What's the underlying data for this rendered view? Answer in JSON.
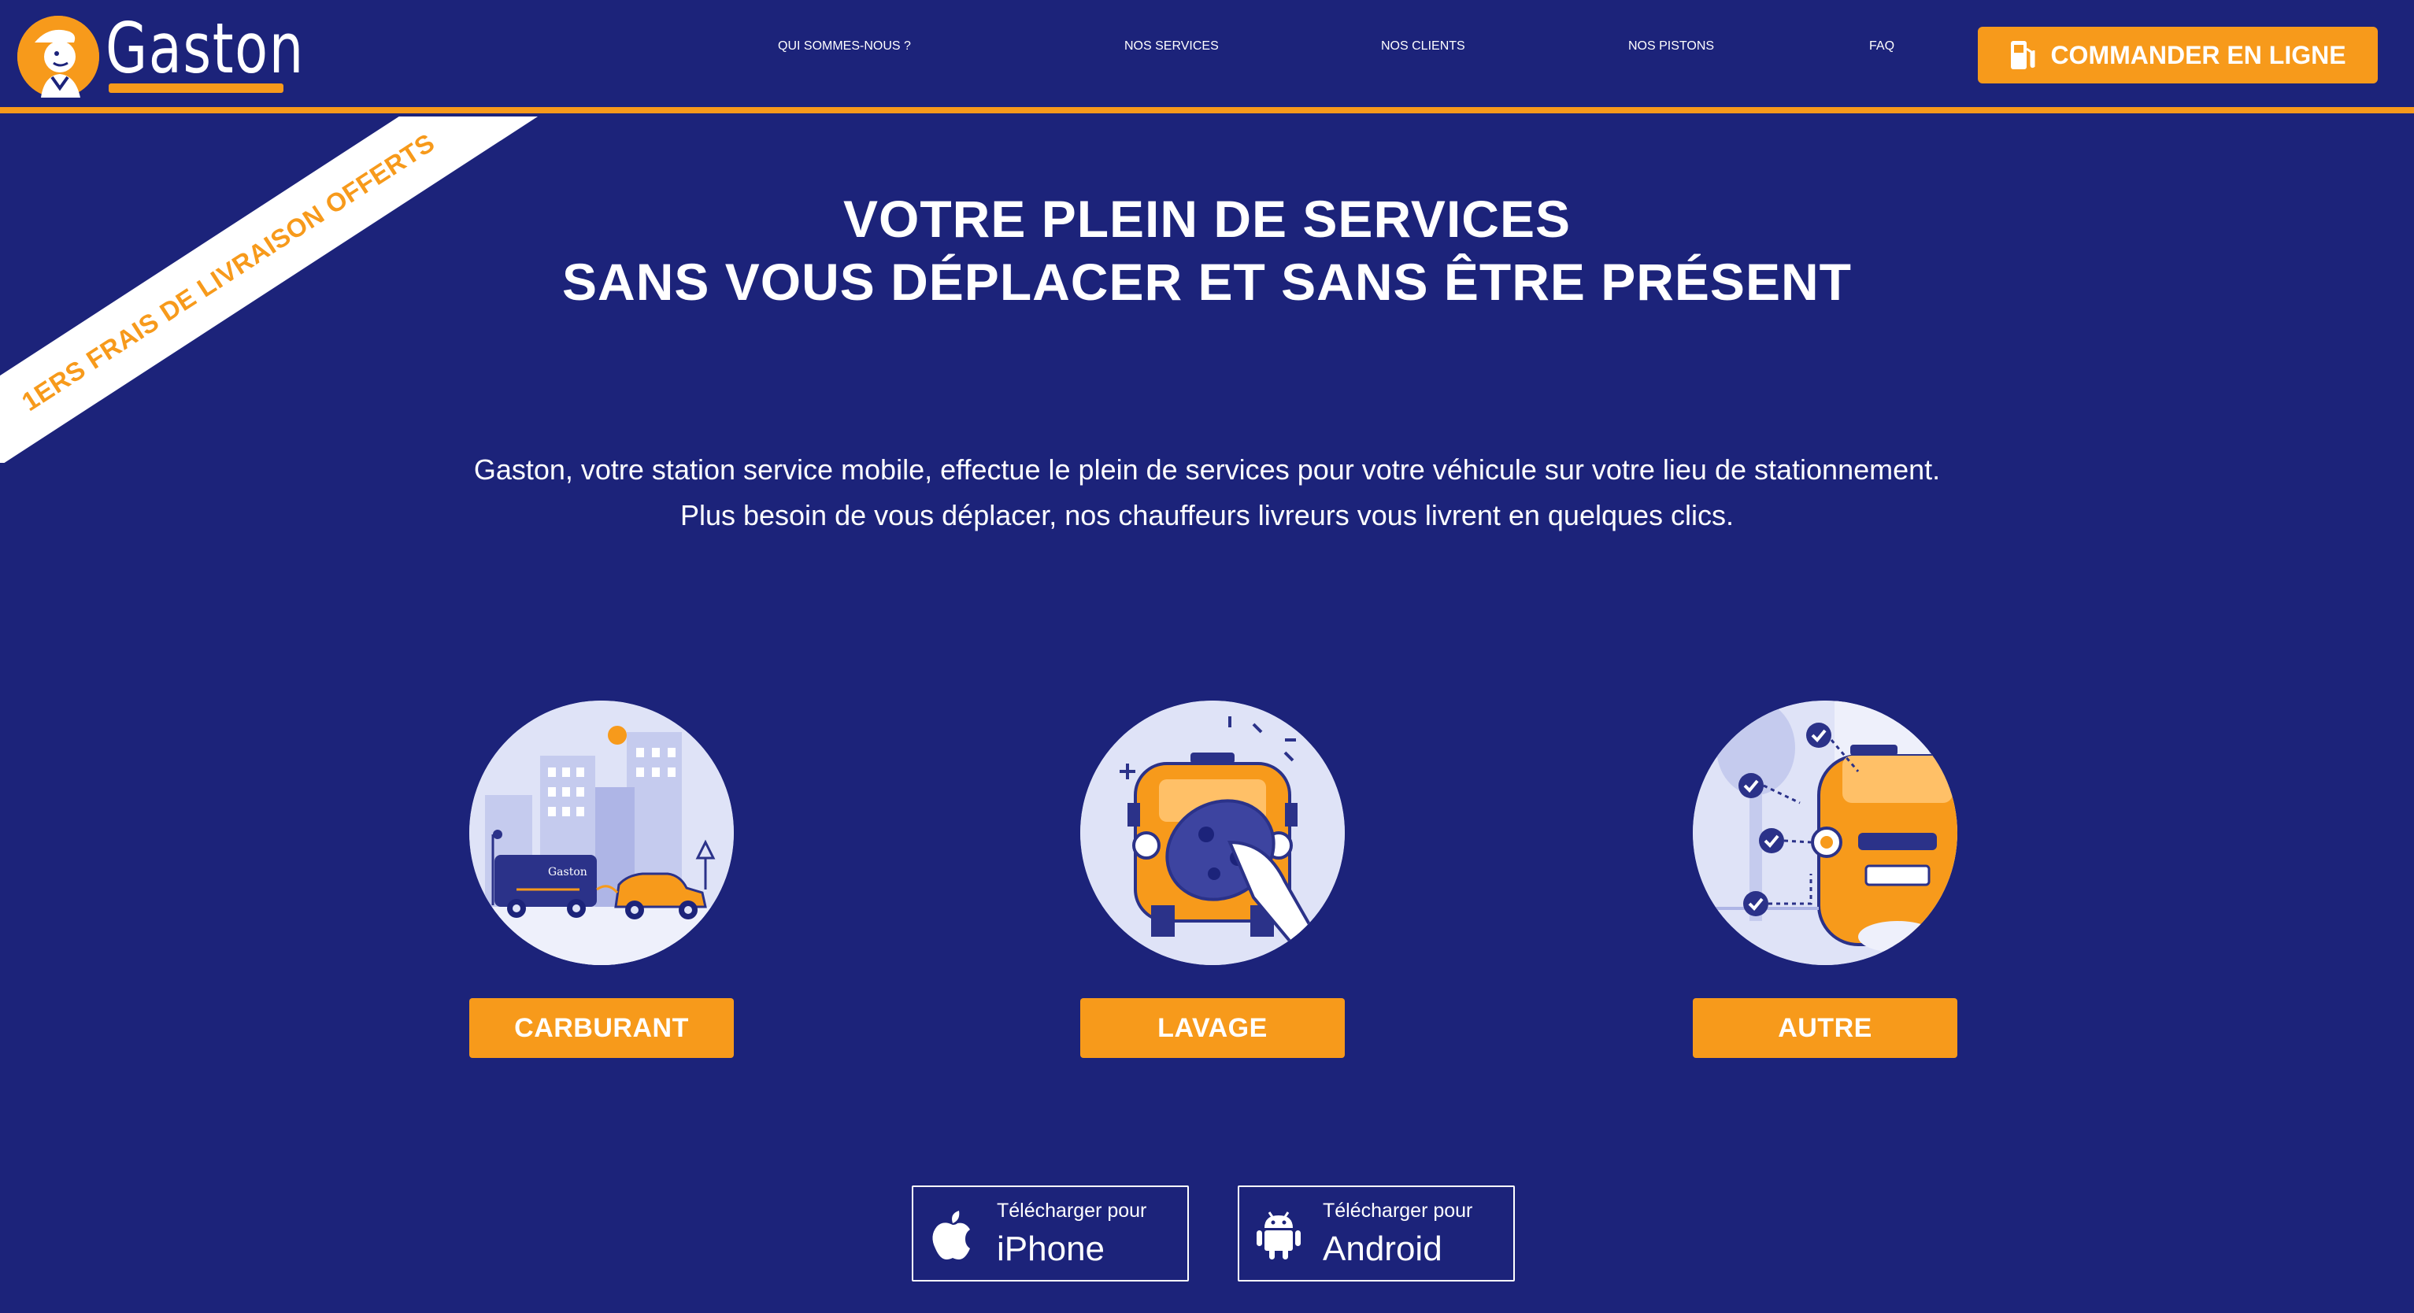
{
  "brand": {
    "name": "Gaston"
  },
  "nav": {
    "items": [
      {
        "label": "QUI SOMMES-NOUS ?"
      },
      {
        "label": "NOS SERVICES"
      },
      {
        "label": "NOS CLIENTS"
      },
      {
        "label": "NOS PISTONS"
      },
      {
        "label": "FAQ"
      }
    ],
    "cta": {
      "label": "COMMANDER EN LIGNE",
      "icon": "fuel-pump-icon"
    }
  },
  "ribbon": {
    "label": "1ERS FRAIS DE LIVRAISON OFFERTS"
  },
  "hero": {
    "title_line1": "VOTRE PLEIN DE SERVICES",
    "title_line2": "SANS VOUS DÉPLACER ET SANS ÊTRE PRÉSENT",
    "desc_line1": "Gaston, votre station service mobile, effectue le plein de services pour votre véhicule sur votre lieu de stationnement.",
    "desc_line2": "Plus besoin de vous déplacer, nos chauffeurs livreurs vous livrent en quelques clics."
  },
  "services": [
    {
      "label": "CARBURANT",
      "illustration": "city-van-car-illustration",
      "van_text": "Gaston"
    },
    {
      "label": "LAVAGE",
      "illustration": "car-wash-sponge-illustration"
    },
    {
      "label": "AUTRE",
      "illustration": "car-checklist-illustration"
    }
  ],
  "downloads": [
    {
      "small": "Télécharger pour",
      "big": "iPhone",
      "icon": "apple-icon"
    },
    {
      "small": "Télécharger pour",
      "big": "Android",
      "icon": "android-icon"
    }
  ],
  "colors": {
    "background": "#1c237a",
    "accent": "#f79a1b",
    "illustration_bg": "#dfe3f7"
  }
}
